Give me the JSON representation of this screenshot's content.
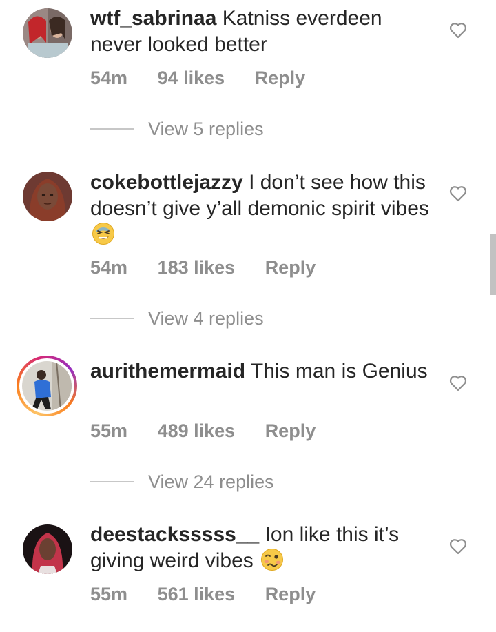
{
  "comments": [
    {
      "username": "wtf_sabrinaa",
      "text": "Katniss everdeen never looked better",
      "emoji": "",
      "time": "54m",
      "likes": "94 likes",
      "reply": "Reply",
      "view_replies": "View 5 replies"
    },
    {
      "username": "cokebottlejazzy",
      "text": "I don’t see how this doesn’t give y’all demonic spirit vibes",
      "emoji": "tired-face",
      "time": "54m",
      "likes": "183 likes",
      "reply": "Reply",
      "view_replies": "View 4 replies"
    },
    {
      "username": "aurithemermaid",
      "text": "This man is Genius",
      "emoji": "",
      "time": "55m",
      "likes": "489 likes",
      "reply": "Reply",
      "view_replies": "View 24 replies"
    },
    {
      "username": "deestacksssss__",
      "text": "Ion like this it’s giving weird vibes",
      "emoji": "woozy-face",
      "time": "55m",
      "likes": "561 likes",
      "reply": "Reply",
      "view_replies": ""
    }
  ],
  "colors": {
    "text": "#262626",
    "secondary": "#8e8e8e",
    "divider": "#c7c7c7",
    "story_ring": [
      "#fdc468",
      "#fa7e1e",
      "#d62976",
      "#962fbf"
    ]
  }
}
